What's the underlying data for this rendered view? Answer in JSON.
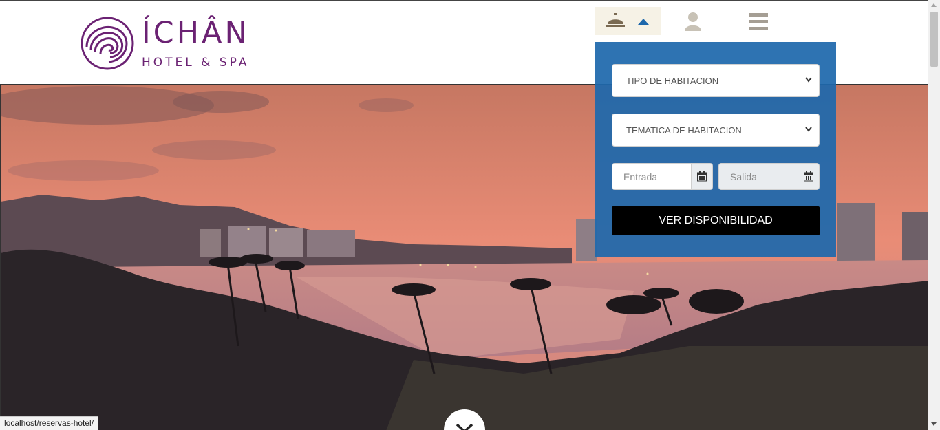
{
  "brand": {
    "name": "ÍCHÂN",
    "subtitle": "HOTEL & SPA",
    "color": "#6b2273"
  },
  "nav": {
    "bell_icon": "concierge-bell-icon",
    "caret_icon": "caret-up-icon",
    "user_icon": "user-icon",
    "menu_icon": "hamburger-menu-icon"
  },
  "booking": {
    "room_type_select": "TIPO DE HABITACION",
    "room_theme_select": "TEMATICA DE HABITACION",
    "checkin_placeholder": "Entrada",
    "checkout_placeholder": "Salida",
    "calendar_icon": "calendar-icon",
    "submit_label": "VER DISPONIBILIDAD",
    "panel_color": "#1e68ac"
  },
  "hero": {
    "image": "sunset-beach-palm-trees-photo"
  },
  "scroll_down_icon": "chevron-down-icon",
  "status_bar": {
    "url": "localhost/reservas-hotel/"
  }
}
